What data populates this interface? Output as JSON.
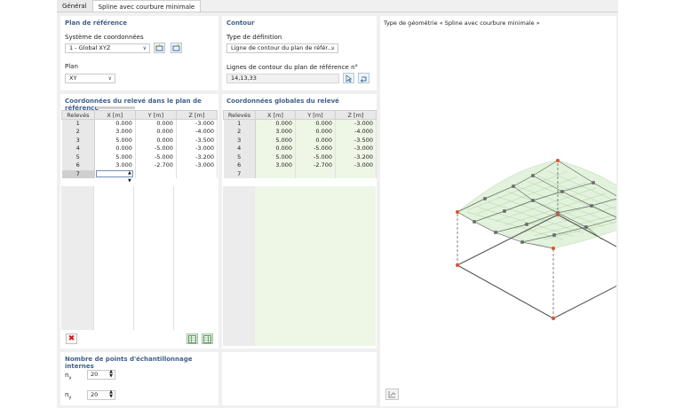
{
  "tabs": [
    {
      "label": "Général",
      "active": false
    },
    {
      "label": "Spline avec courbure minimale",
      "active": true
    }
  ],
  "reference_plane": {
    "title": "Plan de référence",
    "coord_system_label": "Système de coordonnées",
    "coord_system_value": "1 - Global XYZ",
    "plane_label": "Plan",
    "plane_value": "XY"
  },
  "contour": {
    "title": "Contour",
    "definition_label": "Type de définition",
    "definition_value": "Ligne de contour du plan de référ...",
    "lines_label": "Lignes de contour du plan de référence n°",
    "lines_value": "14,13,33"
  },
  "local_table": {
    "title": "Coordonnées du relevé dans le plan de référence",
    "headers": [
      "Relevés",
      "X [m]",
      "Y [m]",
      "Z [m]"
    ],
    "rows": [
      [
        "1",
        "0.000",
        "0.000",
        "-3.000"
      ],
      [
        "2",
        "3.000",
        "0.000",
        "-4.000"
      ],
      [
        "3",
        "5.000",
        "0.000",
        "-3.500"
      ],
      [
        "4",
        "0.000",
        "-5.000",
        "-3.000"
      ],
      [
        "5",
        "5.000",
        "-5.000",
        "-3.200"
      ],
      [
        "6",
        "3.000",
        "-2.700",
        "-3.000"
      ],
      [
        "7",
        "",
        "",
        ""
      ]
    ]
  },
  "global_table": {
    "title": "Coordonnées globales du relevé",
    "headers": [
      "Relevés",
      "X [m]",
      "Y [m]",
      "Z [m]"
    ],
    "rows": [
      [
        "1",
        "0.000",
        "0.000",
        "-3.000"
      ],
      [
        "2",
        "3.000",
        "0.000",
        "-4.000"
      ],
      [
        "3",
        "5.000",
        "0.000",
        "-3.500"
      ],
      [
        "4",
        "0.000",
        "-5.000",
        "-3.000"
      ],
      [
        "5",
        "5.000",
        "-5.000",
        "-3.200"
      ],
      [
        "6",
        "3.000",
        "-2.700",
        "-3.000"
      ],
      [
        "7",
        "",
        "",
        ""
      ]
    ]
  },
  "sampling": {
    "title": "Nombre de points d'échantillonnage internes",
    "nx_label": "n",
    "nx_sub": "x",
    "nx_value": "20",
    "ny_label": "n",
    "ny_sub": "y",
    "ny_value": "20"
  },
  "preview": {
    "title": "Type de géométrie « Spline avec courbure minimale »"
  },
  "icons": {
    "delete": "delete-row-icon",
    "excel_export": "excel-export-icon",
    "excel_import": "excel-import-icon",
    "pick": "pick-in-graphic-icon",
    "coord_new": "new-coordinate-system-icon",
    "coord_edit": "edit-coordinate-system-icon"
  },
  "colors": {
    "title_blue": "#3f5f8a",
    "surface_green": "#dff0d6",
    "point_red": "#e0522d",
    "point_gray": "#6a6a6a"
  }
}
